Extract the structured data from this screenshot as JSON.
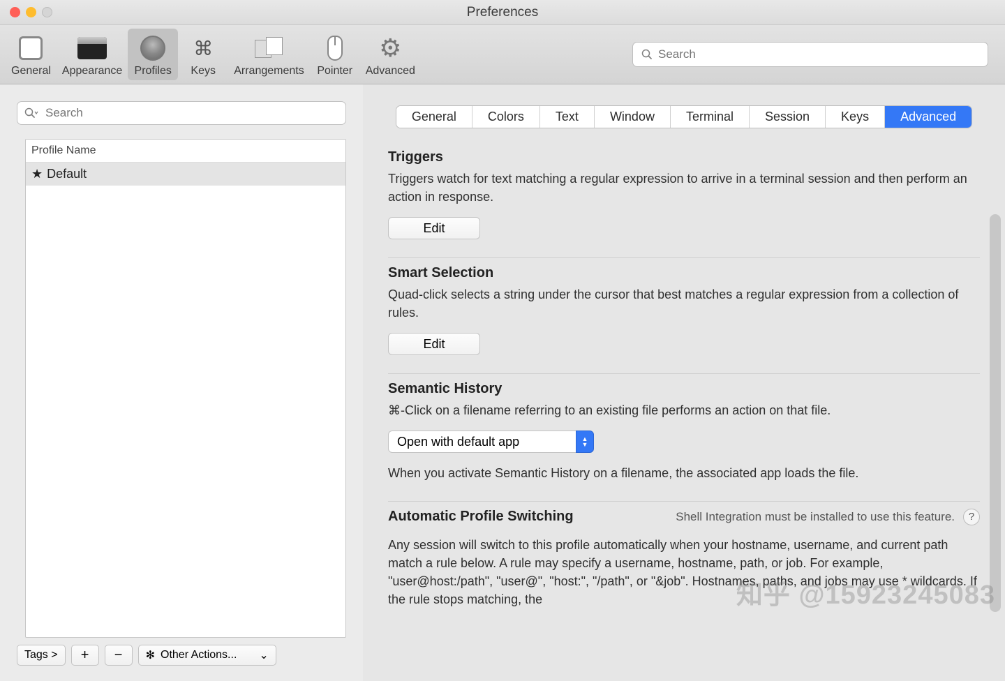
{
  "window": {
    "title": "Preferences"
  },
  "toolbar": {
    "items": [
      {
        "label": "General"
      },
      {
        "label": "Appearance"
      },
      {
        "label": "Profiles"
      },
      {
        "label": "Keys"
      },
      {
        "label": "Arrangements"
      },
      {
        "label": "Pointer"
      },
      {
        "label": "Advanced"
      }
    ],
    "search_placeholder": "Search"
  },
  "sidebar": {
    "search_placeholder": "Search",
    "list_header": "Profile Name",
    "profiles": [
      {
        "name": "Default",
        "starred": true
      }
    ],
    "tags_label": "Tags >",
    "other_actions_label": "Other Actions..."
  },
  "tabs": [
    "General",
    "Colors",
    "Text",
    "Window",
    "Terminal",
    "Session",
    "Keys",
    "Advanced"
  ],
  "active_tab": "Advanced",
  "sections": {
    "triggers": {
      "title": "Triggers",
      "desc": "Triggers watch for text matching a regular expression to arrive in a terminal session and then perform an action in response.",
      "button": "Edit"
    },
    "smart_selection": {
      "title": "Smart Selection",
      "desc": "Quad-click selects a string under the cursor that best matches a regular expression from a collection of rules.",
      "button": "Edit"
    },
    "semantic_history": {
      "title": "Semantic History",
      "desc": "⌘-Click on a filename referring to an existing file performs an action on that file.",
      "dropdown_value": "Open with default app",
      "note": "When you activate Semantic History on a filename, the associated app loads the file."
    },
    "automatic_profile_switching": {
      "title": "Automatic Profile Switching",
      "hint": "Shell Integration must be installed to use this feature.",
      "desc": "Any session will switch to this profile automatically when your hostname, username, and current path match a rule below. A rule may specify a username, hostname, path, or job. For example, \"user@host:/path\", \"user@\", \"host:\", \"/path\", or \"&job\". Hostnames, paths, and jobs may use * wildcards. If the rule stops matching, the"
    }
  },
  "watermark": "知乎 @15923245083"
}
